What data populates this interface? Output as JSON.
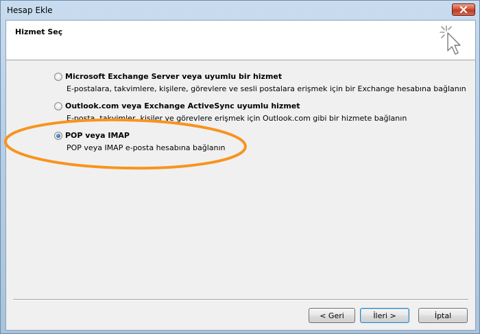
{
  "window": {
    "title": "Hesap Ekle"
  },
  "header": {
    "title": "Hizmet Seç"
  },
  "options": [
    {
      "title": "Microsoft Exchange Server veya uyumlu bir hizmet",
      "description": "E-postalara, takvimlere, kişilere, görevlere ve sesli postalara erişmek için bir Exchange hesabına bağlanın",
      "selected": false
    },
    {
      "title": "Outlook.com veya Exchange ActiveSync uyumlu hizmet",
      "description": "E-posta, takvimler, kişiler ve görevlere erişmek için Outlook.com gibi bir hizmete bağlanın",
      "selected": false
    },
    {
      "title": "POP veya IMAP",
      "description": "POP veya IMAP e-posta hesabına bağlanın",
      "selected": true
    }
  ],
  "buttons": {
    "back": "< Geri",
    "next": "İleri >",
    "cancel": "İptal"
  },
  "colors": {
    "highlight": "#f7941d",
    "radio_selected": "#2a5fa8"
  }
}
